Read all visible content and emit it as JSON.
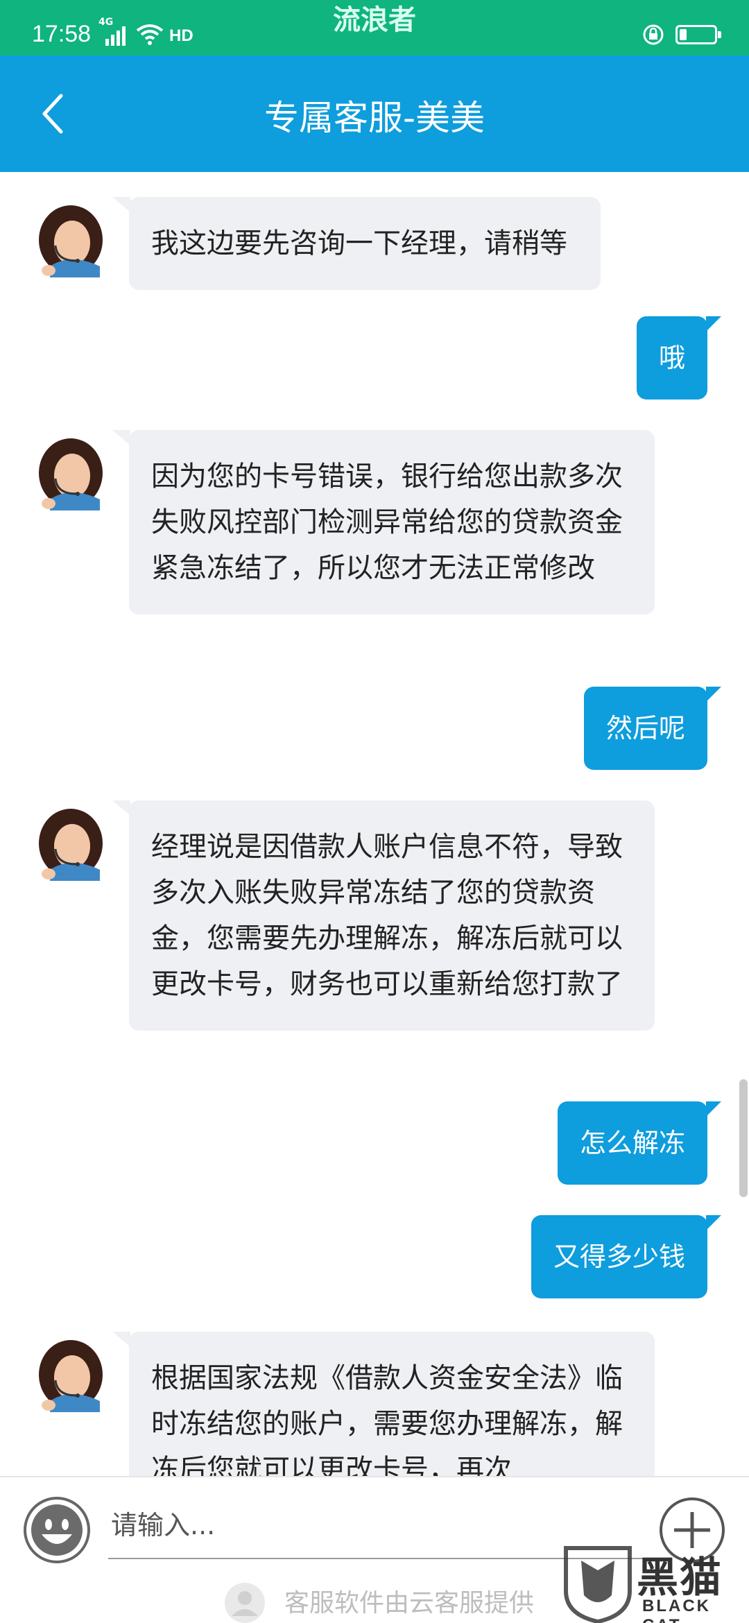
{
  "status_bar": {
    "time": "17:58",
    "network": "4G",
    "hd": "HD",
    "watermark": "流浪者",
    "battery_level": 0.2
  },
  "header": {
    "title": "专属客服-美美"
  },
  "messages": [
    {
      "from": "agent",
      "text": "我这边要先咨询一下经理，请稍等"
    },
    {
      "from": "user",
      "text": "哦"
    },
    {
      "from": "agent",
      "text": "因为您的卡号错误，银行给您出款多次失败风控部门检测异常给您的贷款资金紧急冻结了，所以您才无法正常修改"
    },
    {
      "from": "user",
      "text": "然后呢"
    },
    {
      "from": "agent",
      "text": "经理说是因借款人账户信息不符，导致多次入账失败异常冻结了您的贷款资金，您需要先办理解冻，解冻后就可以更改卡号，财务也可以重新给您打款了"
    },
    {
      "from": "user",
      "text": "怎么解冻"
    },
    {
      "from": "user",
      "text": "又得多少钱"
    },
    {
      "from": "agent",
      "text": "根据国家法规《借款人资金安全法》临时冻结您的账户，需要您办理解冻，解冻后您就可以更改卡号，再次"
    }
  ],
  "input": {
    "placeholder": "请输入..."
  },
  "footer": {
    "text": "客服软件由云客服提供"
  },
  "watermark": {
    "name": "黑猫",
    "sub": "BLACK CAT"
  },
  "colors": {
    "status_bar": "#0fb47e",
    "header": "#0e9ddd",
    "user_bubble": "#0e9ddd",
    "agent_bubble": "#eff0f3"
  }
}
